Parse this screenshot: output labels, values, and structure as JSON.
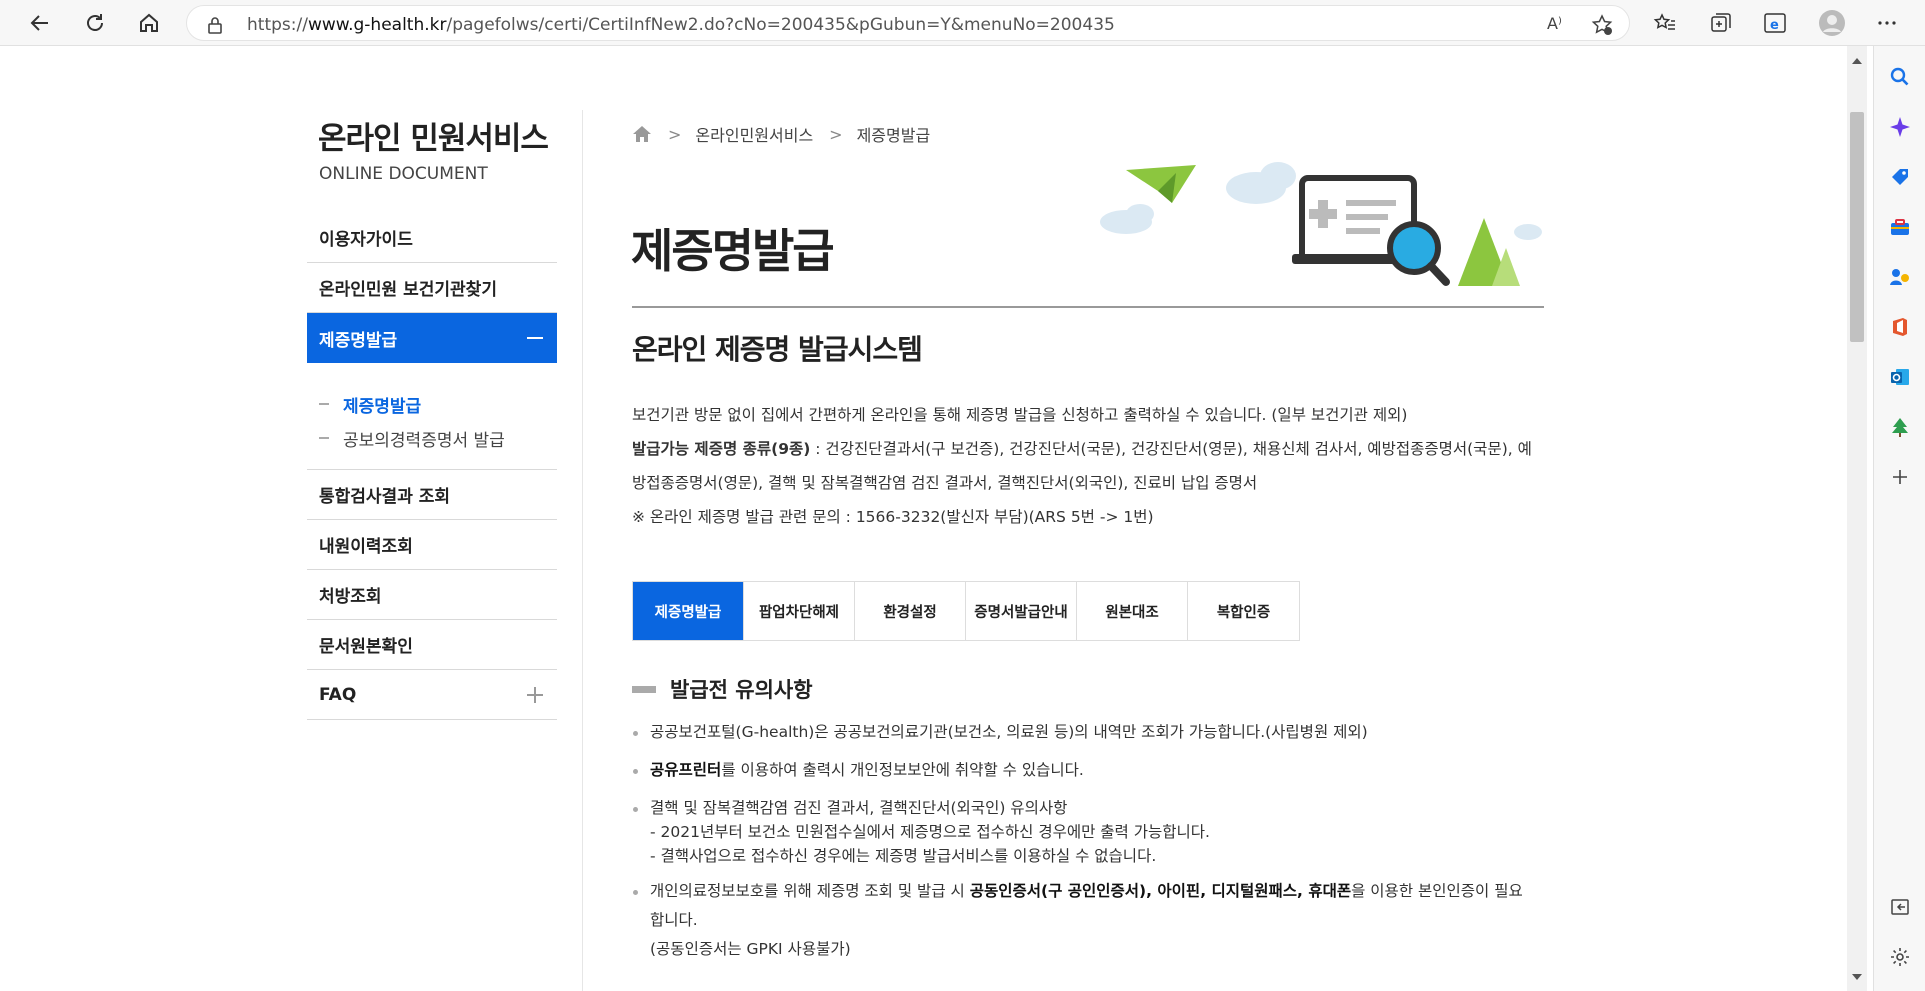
{
  "browser": {
    "url_prefix": "https://",
    "url_domain": "www.g-health.kr",
    "url_path": "/pagefolws/certi/CertiInfNew2.do?cNo=200435&pGubun=Y&menuNo=200435",
    "read_aloud_label": "A⁾"
  },
  "lnb": {
    "title": "온라인 민원서비스",
    "subtitle": "ONLINE DOCUMENT",
    "items": [
      {
        "label": "이용자가이드"
      },
      {
        "label": "온라인민원 보건기관찾기"
      },
      {
        "label": "제증명발급"
      },
      {
        "label": "통합검사결과 조회"
      },
      {
        "label": "내원이력조회"
      },
      {
        "label": "처방조회"
      },
      {
        "label": "문서원본확인"
      },
      {
        "label": "FAQ"
      }
    ],
    "submenu": [
      {
        "label": "제증명발급"
      },
      {
        "label": "공보의경력증명서 발급"
      }
    ]
  },
  "breadcrumb": {
    "items": [
      "온라인민원서비스",
      "제증명발급"
    ]
  },
  "main": {
    "page_title": "제증명발급",
    "section_title": "온라인 제증명 발급시스템",
    "desc_line1": "보건기관 방문 없이 집에서 간편하게 온라인을 통해 제증명 발급을 신청하고 출력하실 수 있습니다. (일부 보건기관 제외)",
    "desc_bold": "발급가능 제증명 종류(9종)",
    "desc_line2": " : 건강진단결과서(구 보건증), 건강진단서(국문), 건강진단서(영문), 채용신체 검사서, 예방접종증명서(국문), 예방접종증명서(영문), 결핵 및 잠복결핵감염 검진 결과서, 결핵진단서(외국인), 진료비 납입 증명서",
    "desc_line3": "※ 온라인 제증명 발급 관련 문의 : 1566-3232(발신자 부담)(ARS 5번 -> 1번)",
    "tabs": [
      {
        "label": "제증명발급"
      },
      {
        "label": "팝업차단해제"
      },
      {
        "label": "환경설정"
      },
      {
        "label": "증명서발급안내"
      },
      {
        "label": "원본대조"
      },
      {
        "label": "복합인증"
      }
    ],
    "notice_title": "발급전 유의사항",
    "notes": {
      "n1": "공공보건포털(G-health)은 공공보건의료기관(보건소, 의료원 등)의 내역만 조회가 가능합니다.(사립병원 제외)",
      "n2_bold": "공유프린터",
      "n2_rest": "를 이용하여 출력시 개인정보보안에 취약할 수 있습니다.",
      "n3_line1": "결핵 및 잠복결핵감염 검진 결과서, 결핵진단서(외국인) 유의사항",
      "n3_line2": "- 2021년부터 보건소 민원접수실에서 제증명으로 접수하신 경우에만 출력 가능합니다.",
      "n3_line3": "- 결핵사업으로 접수하신 경우에는 제증명 발급서비스를 이용하실 수 없습니다.",
      "n4_a": "개인의료정보보호를 위해 제증명 조회 및 발급 시 ",
      "n4_b1": "공동인증서(구 공인인증서), 아이핀, 디지털원패스, 휴대폰",
      "n4_c": "을 이용한 본인인증이 필요합니다.",
      "n4_line2": "(공동인증서는 GPKI 사용불가)"
    }
  },
  "colors": {
    "accent": "#0a66e0",
    "hero_green": "#8cc63f",
    "hero_blue": "#29abe2",
    "hero_dark": "#333333"
  }
}
